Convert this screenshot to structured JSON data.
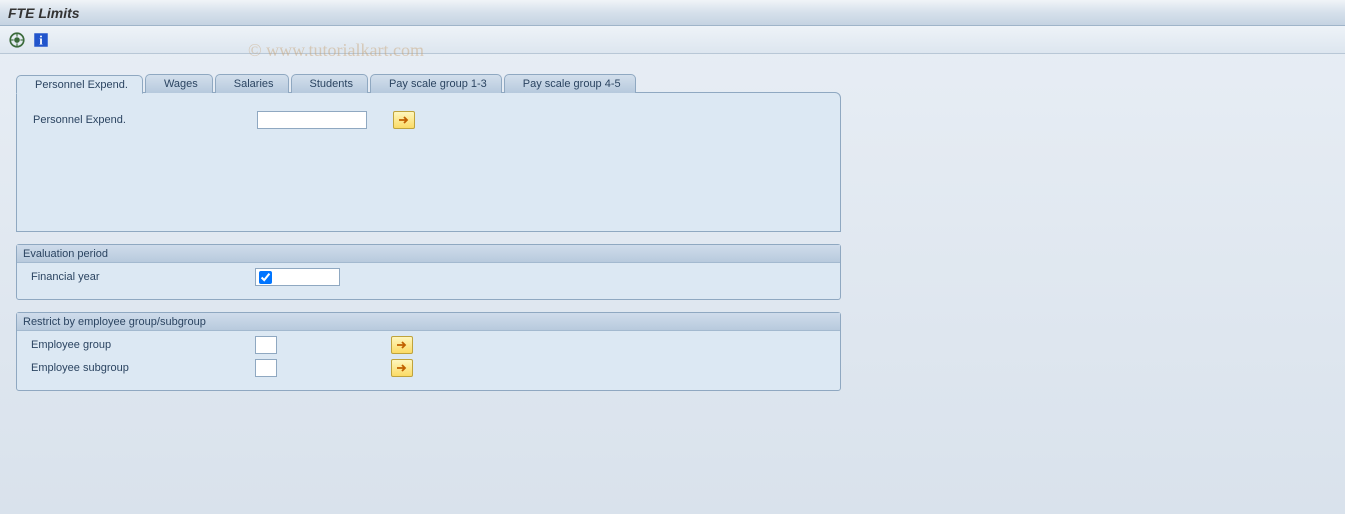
{
  "title": "FTE Limits",
  "watermark": "© www.tutorialkart.com",
  "tabs": [
    {
      "label": "Personnel Expend.",
      "active": true
    },
    {
      "label": "Wages",
      "active": false
    },
    {
      "label": "Salaries",
      "active": false
    },
    {
      "label": "Students",
      "active": false
    },
    {
      "label": "Pay scale group 1-3",
      "active": false
    },
    {
      "label": "Pay scale group 4-5",
      "active": false
    }
  ],
  "panel": {
    "field_label": "Personnel Expend.",
    "field_value": ""
  },
  "evaluation": {
    "header": "Evaluation period",
    "field_label": "Financial year",
    "checked": true
  },
  "restrict": {
    "header": "Restrict by employee group/subgroup",
    "rows": [
      {
        "label": "Employee group",
        "value": ""
      },
      {
        "label": "Employee subgroup",
        "value": ""
      }
    ]
  }
}
